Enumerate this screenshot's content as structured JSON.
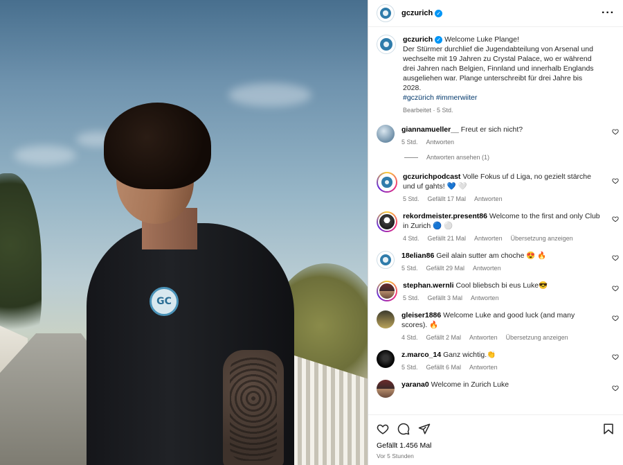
{
  "post": {
    "account": "gczurich",
    "caption_intro": "Welcome Luke Plange!",
    "caption_body": "Der Stürmer durchlief die Jugendabteilung von Arsenal und wechselte mit 19 Jahren zu Crystal Palace, wo er während drei Jahren nach Belgien, Finnland und innerhalb Englands ausgeliehen war. Plange unterschreibt für drei Jahre bis 2028.",
    "hashtags": [
      "#gczürich",
      "#immerwiiter"
    ],
    "caption_meta": "Bearbeitet · 5 Std.",
    "photo_badge_text": "GC"
  },
  "comments": [
    {
      "user": "giannamueller__",
      "text": "Freut er sich nicht?",
      "time": "5 Std.",
      "likes": "",
      "reply": "Antworten",
      "translate": "",
      "view_replies": "Antworten ansehen (1)"
    },
    {
      "user": "gczurichpodcast",
      "text": "Volle Fokus uf d Liga, no gezielt stärche und uf gahts! 💙 🤍",
      "time": "5 Std.",
      "likes": "Gefällt 17 Mal",
      "reply": "Antworten",
      "translate": ""
    },
    {
      "user": "rekordmeister.present86",
      "text": "Welcome to the first and only Club in Zurich 🔵 ⚪",
      "time": "4 Std.",
      "likes": "Gefällt 21 Mal",
      "reply": "Antworten",
      "translate": "Übersetzung anzeigen"
    },
    {
      "user": "18elian86",
      "text": "Geil alain sutter am choche 😍 🔥",
      "time": "5 Std.",
      "likes": "Gefällt 29 Mal",
      "reply": "Antworten",
      "translate": ""
    },
    {
      "user": "stephan.wernli",
      "text": "Cool bliebsch bi eus Luke😎",
      "time": "5 Std.",
      "likes": "Gefällt 3 Mal",
      "reply": "Antworten",
      "translate": ""
    },
    {
      "user": "gleiser1886",
      "text": "Welcome Luke and good luck (and many scores). 🔥",
      "time": "4 Std.",
      "likes": "Gefällt 2 Mal",
      "reply": "Antworten",
      "translate": "Übersetzung anzeigen"
    },
    {
      "user": "z.marco_14",
      "text": "Ganz wichtig.👏",
      "time": "5 Std.",
      "likes": "Gefällt 6 Mal",
      "reply": "Antworten",
      "translate": ""
    },
    {
      "user": "yarana0",
      "text": "Welcome in Zurich Luke",
      "time": "",
      "likes": "",
      "reply": "",
      "translate": ""
    }
  ],
  "footer": {
    "likes": "Gefällt 1.456 Mal",
    "time": "Vor 5 Stunden"
  },
  "icons": [
    "heart-icon",
    "comment-icon",
    "share-icon",
    "bookmark-icon",
    "more-icon",
    "verified-icon"
  ],
  "colors": {
    "link": "#00376b",
    "verified": "#0095f6",
    "meta": "#737373"
  }
}
